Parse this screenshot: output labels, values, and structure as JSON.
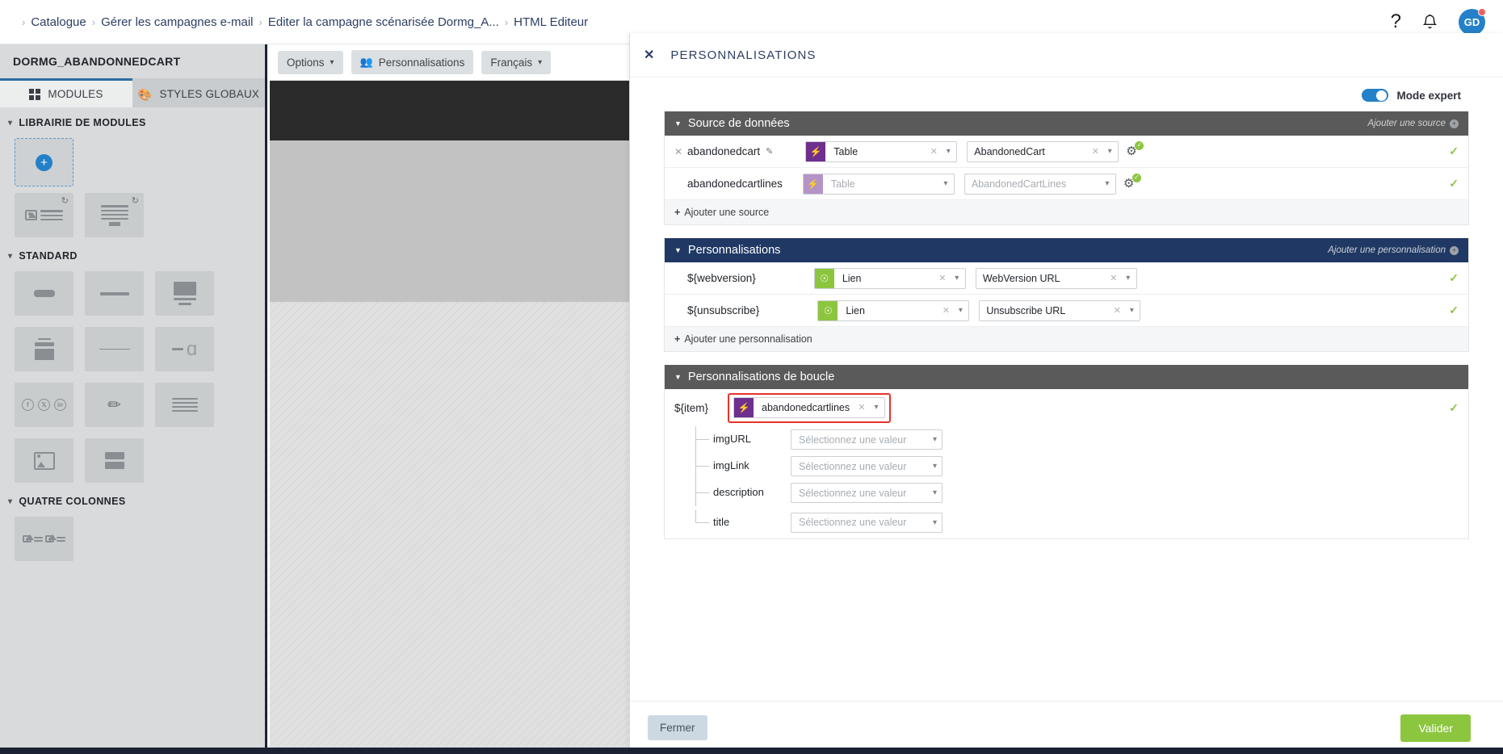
{
  "topbar": {
    "breadcrumb": [
      "Catalogue",
      "Gérer les campagnes e-mail",
      "Editer la campagne scénarisée Dormg_A...",
      "HTML Editeur"
    ],
    "separator": "›",
    "help_icon": "question-mark-icon",
    "bell_icon": "bell-icon",
    "avatar_initials": "GD"
  },
  "sidebar": {
    "title": "DORMG_ABANDONNEDCART",
    "tabs": [
      {
        "label": "MODULES",
        "icon": "grid-icon",
        "active": true
      },
      {
        "label": "STYLES GLOBAUX",
        "icon": "palette-icon",
        "active": false
      }
    ],
    "sections": [
      {
        "label": "LIBRAIRIE DE MODULES"
      },
      {
        "label": "STANDARD"
      },
      {
        "label": "QUATRE COLONNES"
      }
    ],
    "add_module_label": "+"
  },
  "canvas": {
    "toolbar": [
      {
        "label": "Options",
        "icon": "chevron-down-icon"
      },
      {
        "label": "Personnalisations",
        "icon": "people-icon"
      },
      {
        "label": "Français",
        "icon": "chevron-down-icon"
      }
    ]
  },
  "panel": {
    "title": "PERSONNALISATIONS",
    "close_icon": "close-icon",
    "expert_mode_label": "Mode expert",
    "expert_mode_on": true,
    "sections": {
      "datasource": {
        "title": "Source de données",
        "add_label": "Ajouter une source",
        "footer_label": "Ajouter une source",
        "rows": [
          {
            "name": "abandonedcart",
            "editable": true,
            "removable": true,
            "type_value": "Table",
            "target_value": "AbandonedCart",
            "enabled": true,
            "status": "valid"
          },
          {
            "name": "abandonedcartlines",
            "editable": false,
            "removable": false,
            "type_value": "Table",
            "target_value": "AbandonedCartLines",
            "enabled": false,
            "status": "valid"
          }
        ]
      },
      "personalisations": {
        "title": "Personnalisations",
        "add_label": "Ajouter une personnalisation",
        "footer_label": "Ajouter une personnalisation",
        "rows": [
          {
            "name": "${webversion}",
            "type_value": "Lien",
            "target_value": "WebVersion URL",
            "status": "valid"
          },
          {
            "name": "${unsubscribe}",
            "type_value": "Lien",
            "target_value": "Unsubscribe URL",
            "status": "valid"
          }
        ]
      },
      "loop": {
        "title": "Personnalisations de boucle",
        "item_label": "${item}",
        "item_value": "abandonedcartlines",
        "item_highlighted": true,
        "item_status": "valid",
        "placeholder": "Sélectionnez une valeur",
        "fields": [
          {
            "label": "imgURL",
            "value": ""
          },
          {
            "label": "imgLink",
            "value": ""
          },
          {
            "label": "description",
            "value": ""
          },
          {
            "label": "title",
            "value": ""
          }
        ]
      }
    },
    "footer": {
      "close_label": "Fermer",
      "validate_label": "Valider"
    }
  },
  "colors": {
    "accent_blue": "#2480c8",
    "navy": "#1f3864",
    "grey_header": "#5a5a5a",
    "green": "#8cc63f",
    "purple": "#6f2f8e",
    "highlight_red": "#e8322a"
  }
}
